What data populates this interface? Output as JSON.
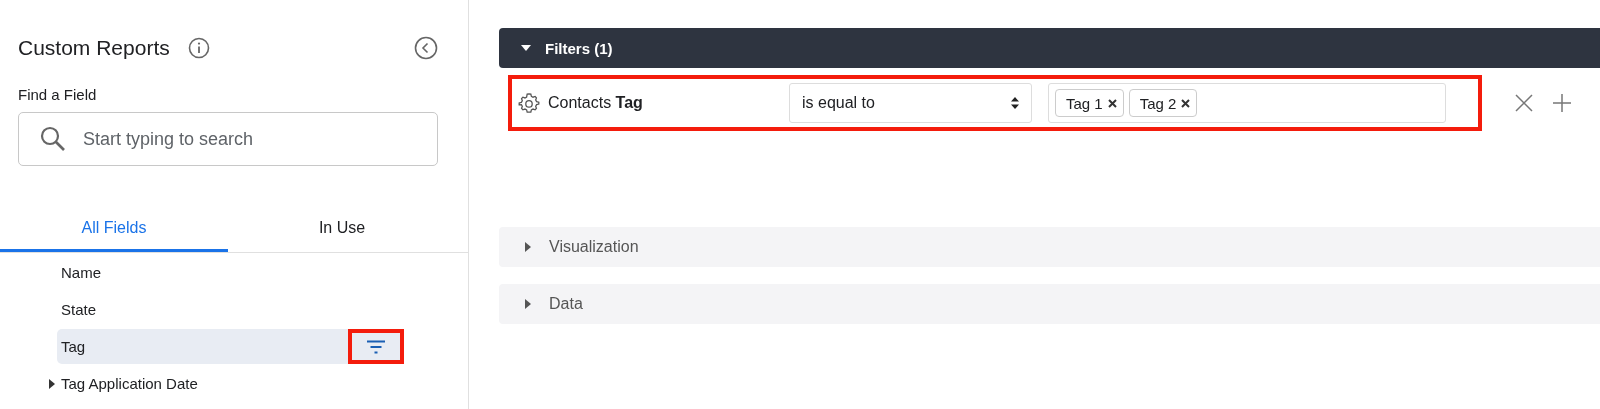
{
  "sidebar": {
    "title": "Custom Reports",
    "find_label": "Find a Field",
    "search": {
      "placeholder": "Start typing to search"
    },
    "tabs": [
      {
        "label": "All Fields",
        "selected": true
      },
      {
        "label": "In Use",
        "selected": false
      }
    ],
    "fields": [
      {
        "label": "Name",
        "selected": false,
        "kind": "field"
      },
      {
        "label": "State",
        "selected": false,
        "kind": "field"
      },
      {
        "label": "Tag",
        "selected": true,
        "kind": "filterable"
      },
      {
        "label": "Tag Application Date",
        "selected": false,
        "kind": "group"
      }
    ]
  },
  "filters": {
    "title": "Filters (1)",
    "expanded": true,
    "rows": [
      {
        "field": "Contacts **Tag**",
        "operator": "is equal to",
        "values": [
          "Tag 1",
          "Tag 2"
        ],
        "highlighted": true
      }
    ]
  },
  "sections": [
    {
      "title": "Visualization",
      "expanded": false
    },
    {
      "title": "Data",
      "expanded": false
    }
  ]
}
